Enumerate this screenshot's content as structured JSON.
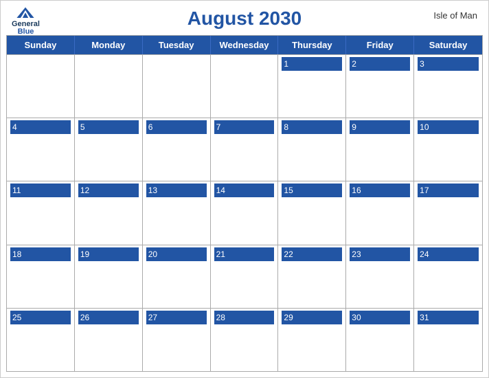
{
  "header": {
    "title": "August 2030",
    "region": "Isle of Man",
    "logo_general": "General",
    "logo_blue": "Blue"
  },
  "days_of_week": [
    "Sunday",
    "Monday",
    "Tuesday",
    "Wednesday",
    "Thursday",
    "Friday",
    "Saturday"
  ],
  "weeks": [
    [
      null,
      null,
      null,
      null,
      1,
      2,
      3
    ],
    [
      4,
      5,
      6,
      7,
      8,
      9,
      10
    ],
    [
      11,
      12,
      13,
      14,
      15,
      16,
      17
    ],
    [
      18,
      19,
      20,
      21,
      22,
      23,
      24
    ],
    [
      25,
      26,
      27,
      28,
      29,
      30,
      31
    ]
  ]
}
